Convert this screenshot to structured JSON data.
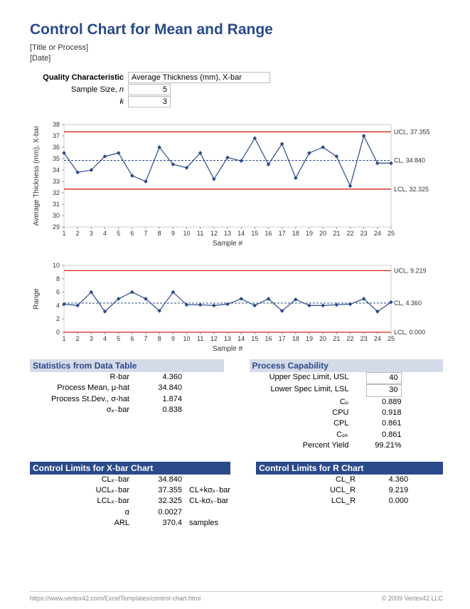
{
  "header": {
    "title": "Control Chart for Mean and Range",
    "title_placeholder": "[Title or Process]",
    "date_placeholder": "[Date]",
    "qc_label": "Quality Characteristic",
    "qc_value": "Average Thickness (mm), X-bar",
    "n_label": "Sample Size, n",
    "n_value": "5",
    "k_label": "k",
    "k_value": "3"
  },
  "footer": {
    "url": "https://www.vertex42.com/ExcelTemplates/control-chart.html",
    "copyright": "© 2009 Vertex42 LLC"
  },
  "chart_data": [
    {
      "type": "line",
      "title": "",
      "ylabel": "Average Thickness (mm), X-bar",
      "xlabel": "Sample #",
      "ylim": [
        29,
        38
      ],
      "yticks": [
        29,
        30,
        31,
        32,
        33,
        34,
        35,
        36,
        37,
        38
      ],
      "categories": [
        1,
        2,
        3,
        4,
        5,
        6,
        7,
        8,
        9,
        10,
        11,
        12,
        13,
        14,
        15,
        16,
        17,
        18,
        19,
        20,
        21,
        22,
        23,
        24,
        25
      ],
      "values": [
        35.5,
        33.8,
        34.0,
        35.2,
        35.5,
        33.5,
        33.0,
        36.0,
        34.5,
        34.2,
        35.5,
        33.2,
        35.1,
        34.8,
        36.8,
        34.5,
        36.3,
        33.3,
        35.5,
        36.0,
        35.2,
        32.6,
        37.0,
        34.6,
        34.6
      ],
      "ucl": {
        "value": 37.355,
        "label": "UCL, 37.355"
      },
      "cl": {
        "value": 34.84,
        "label": "CL, 34.840"
      },
      "lcl": {
        "value": 32.325,
        "label": "LCL, 32.325"
      }
    },
    {
      "type": "line",
      "title": "",
      "ylabel": "Range",
      "xlabel": "Sample #",
      "ylim": [
        0,
        10
      ],
      "yticks": [
        0,
        2,
        4,
        6,
        8,
        10
      ],
      "categories": [
        1,
        2,
        3,
        4,
        5,
        6,
        7,
        8,
        9,
        10,
        11,
        12,
        13,
        14,
        15,
        16,
        17,
        18,
        19,
        20,
        21,
        22,
        23,
        24,
        25
      ],
      "values": [
        4.2,
        4.0,
        6.0,
        3.1,
        5.0,
        6.0,
        5.0,
        3.2,
        6.0,
        4.1,
        4.1,
        4.0,
        4.2,
        5.0,
        4.0,
        5.0,
        3.2,
        4.9,
        4.0,
        4.0,
        4.1,
        4.2,
        5.0,
        3.1,
        4.5
      ],
      "ucl": {
        "value": 9.219,
        "label": "UCL, 9.219"
      },
      "cl": {
        "value": 4.36,
        "label": "CL, 4.360"
      },
      "lcl": {
        "value": 0.0,
        "label": "LCL, 0.000"
      }
    }
  ],
  "stats": {
    "title": "Statistics from Data Table",
    "rows": [
      {
        "label": "R-bar",
        "value": "4.360"
      },
      {
        "label": "Process Mean, μ-hat",
        "value": "34.840"
      },
      {
        "label": "Process St.Dev., σ-hat",
        "value": "1.874"
      },
      {
        "label": "σₓ₋bar",
        "value": "0.838"
      }
    ]
  },
  "capability": {
    "title": "Process Capability",
    "usl_label": "Upper Spec Limit, USL",
    "usl_value": "40",
    "lsl_label": "Lower Spec Limit, LSL",
    "lsl_value": "30",
    "rows": [
      {
        "label": "Cₚ",
        "value": "0.889"
      },
      {
        "label": "CPU",
        "value": "0.918"
      },
      {
        "label": "CPL",
        "value": "0.861"
      },
      {
        "label": "Cₚₖ",
        "value": "0.861"
      },
      {
        "label": "Percent Yield",
        "value": "99.21%"
      }
    ]
  },
  "xbar_limits": {
    "title": "Control Limits for X-bar Chart",
    "rows": [
      {
        "label": "CLₓ₋bar",
        "value": "34.840",
        "extra": ""
      },
      {
        "label": "UCLₓ₋bar",
        "value": "37.355",
        "extra": "CL+kσₓ₋bar"
      },
      {
        "label": "LCLₓ₋bar",
        "value": "32.325",
        "extra": "CL-kσₓ₋bar"
      },
      {
        "label": "α",
        "value": "0.0027",
        "extra": ""
      },
      {
        "label": "ARL",
        "value": "370.4",
        "extra": "samples"
      }
    ]
  },
  "r_limits": {
    "title": "Control Limits for R Chart",
    "rows": [
      {
        "label": "CL_R",
        "value": "4.360"
      },
      {
        "label": "UCL_R",
        "value": "9.219"
      },
      {
        "label": "LCL_R",
        "value": "0.000"
      }
    ]
  }
}
